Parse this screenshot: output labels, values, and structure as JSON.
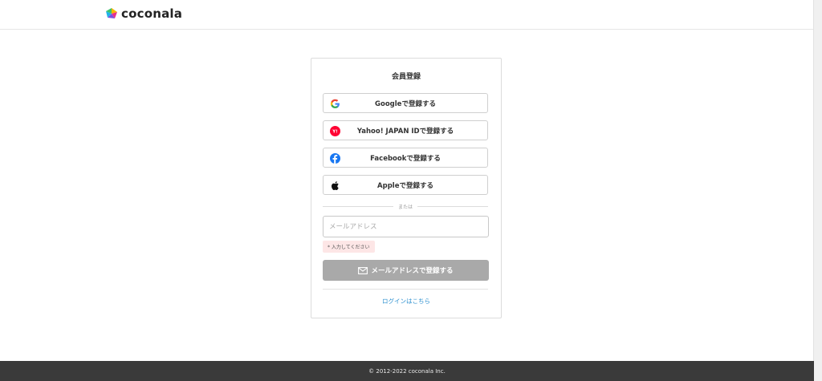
{
  "header": {
    "brand": "coconala"
  },
  "signup": {
    "title": "会員登録",
    "google_label": "Googleで登録する",
    "yahoo_label": "Yahoo! JAPAN IDで登録する",
    "facebook_label": "Facebookで登録する",
    "apple_label": "Appleで登録する",
    "divider_text": "または",
    "email_placeholder": "メールアドレス",
    "email_value": "",
    "error_text": "* 入力してください",
    "email_button_label": "メールアドレスで登録する",
    "login_link": "ログインはこちら"
  },
  "footer": {
    "copyright": "© 2012-2022 coconala Inc."
  },
  "colors": {
    "google_blue": "#4285F4",
    "yahoo_red": "#ff0033",
    "facebook_blue": "#1877F2",
    "disabled_button": "#a9a9a9",
    "error_bg": "#fde6e6",
    "link_blue": "#2b8fcf",
    "footer_bg": "#3a3a3a"
  },
  "icons": {
    "logo": "coconala-logo-icon",
    "google": "google-icon",
    "yahoo": "yahoo-icon",
    "facebook": "facebook-icon",
    "apple": "apple-icon",
    "mail": "mail-icon"
  }
}
